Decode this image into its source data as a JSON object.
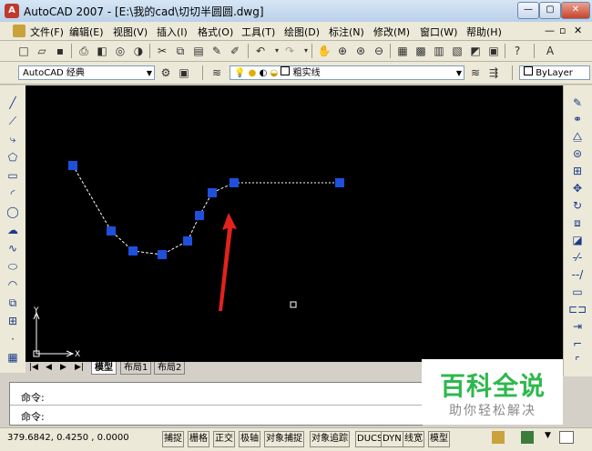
{
  "window": {
    "title": "AutoCAD 2007 - [E:\\我的cad\\切切半圆圆.dwg]",
    "app_icon_glyph": "A",
    "minimize": "—",
    "maximize": "▢",
    "close": "✕"
  },
  "menu": [
    "文件(F)",
    "编辑(E)",
    "视图(V)",
    "插入(I)",
    "格式(O)",
    "工具(T)",
    "绘图(D)",
    "标注(N)",
    "修改(M)",
    "窗口(W)",
    "帮助(H)"
  ],
  "menu_controls": [
    "—",
    "▫",
    "✕"
  ],
  "toolbar2": {
    "workspace": "AutoCAD 经典",
    "linetype": "粗实线",
    "lineweight": "ByLayer"
  },
  "canvas": {
    "background": "#000000",
    "grip_color": "#1e50dc",
    "line_color": "#ffffff",
    "arrow_color": "#e2231a",
    "ucs": {
      "x_label": "X",
      "y_label": "Y"
    }
  },
  "tabs": {
    "nav": [
      "|◀",
      "◀",
      "▶",
      "▶|"
    ],
    "items": [
      "模型",
      "布局1",
      "布局2"
    ]
  },
  "command": {
    "line1": "命令:",
    "line2": "命令:"
  },
  "status": {
    "coords": "379.6842, 0.4250 , 0.0000",
    "buttons": [
      "捕捉",
      "栅格",
      "正交",
      "极轴",
      "对象捕捉",
      "对象追踪",
      "DUCS",
      "DYN",
      "线宽",
      "模型"
    ]
  },
  "watermark": {
    "title": "百科全说",
    "subtitle": "助你轻松解决"
  }
}
